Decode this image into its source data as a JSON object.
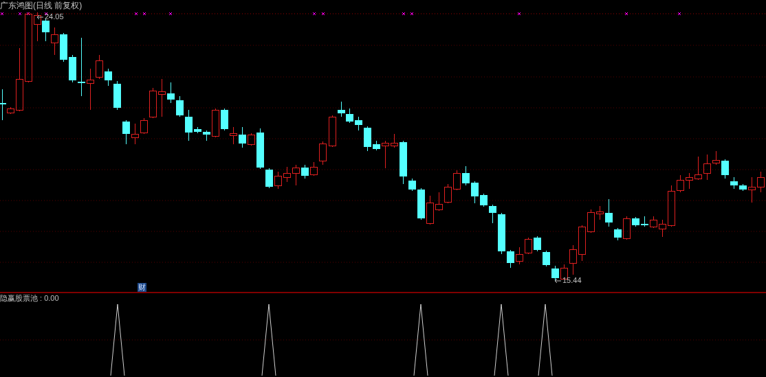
{
  "chart": {
    "title": "广东鸿图(日线 前复权)",
    "high_label": "24.05",
    "low_label": "15.44",
    "event_marker": "财"
  },
  "indicator": {
    "label": "隐赢股票池 : 0.00"
  }
}
